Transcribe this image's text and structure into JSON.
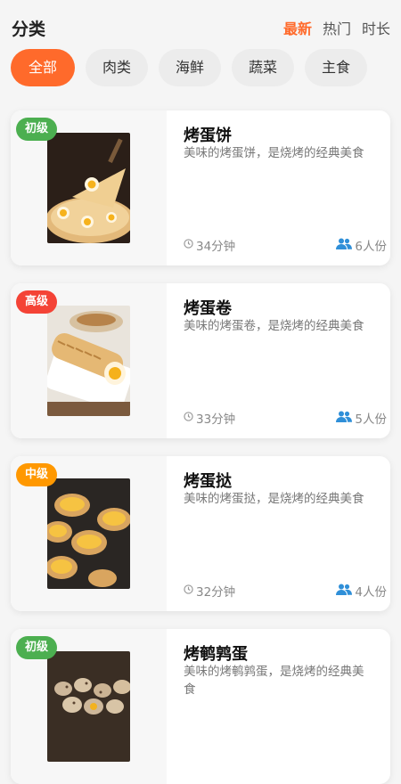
{
  "header": {
    "title": "分类"
  },
  "sort_tabs": [
    {
      "label": "最新",
      "active": true
    },
    {
      "label": "热门",
      "active": false
    },
    {
      "label": "时长",
      "active": false
    }
  ],
  "categories": [
    "全部",
    "肉类",
    "海鲜",
    "蔬菜",
    "主食"
  ],
  "recipes": [
    {
      "title": "烤蛋饼",
      "desc": "美味的烤蛋饼，是烧烤的经典美食",
      "level": "初级",
      "level_color": "#4caf50",
      "time": "34分钟",
      "serves": "6人份"
    },
    {
      "title": "烤蛋卷",
      "desc": "美味的烤蛋卷，是烧烤的经典美食",
      "level": "高级",
      "level_color": "#f44336",
      "time": "33分钟",
      "serves": "5人份"
    },
    {
      "title": "烤蛋挞",
      "desc": "美味的烤蛋挞，是烧烤的经典美食",
      "level": "中级",
      "level_color": "#ff9800",
      "time": "32分钟",
      "serves": "4人份"
    },
    {
      "title": "烤鹌鹑蛋",
      "desc": "美味的烤鹌鹑蛋，是烧烤的经典美食",
      "level": "初级",
      "level_color": "#4caf50",
      "time": "",
      "serves": ""
    }
  ],
  "icons": {
    "time": "clock-icon",
    "serves": "people-icon"
  },
  "colors": {
    "accent": "#ff6a2b",
    "people_icon": "#2f8fd8"
  }
}
